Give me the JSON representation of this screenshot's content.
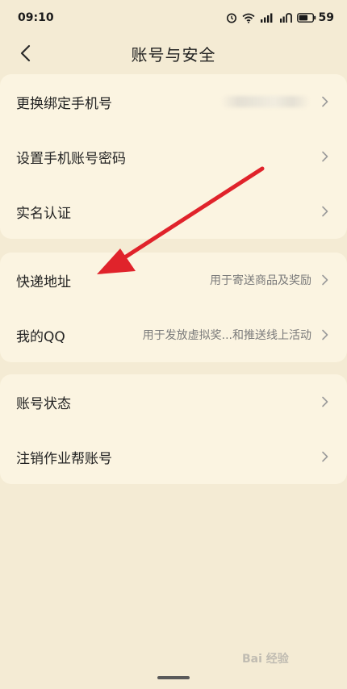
{
  "status_bar": {
    "time": "09:10",
    "battery": "59"
  },
  "nav": {
    "title": "账号与安全"
  },
  "groups": [
    {
      "rows": [
        {
          "label": "更换绑定手机号",
          "hint": ""
        },
        {
          "label": "设置手机账号密码",
          "hint": ""
        },
        {
          "label": "实名认证",
          "hint": ""
        }
      ]
    },
    {
      "rows": [
        {
          "label": "快递地址",
          "hint": "用于寄送商品及奖励"
        },
        {
          "label": "我的QQ",
          "hint": "用于发放虚拟奖...和推送线上活动"
        }
      ]
    },
    {
      "rows": [
        {
          "label": "账号状态",
          "hint": ""
        },
        {
          "label": "注销作业帮账号",
          "hint": ""
        }
      ]
    }
  ],
  "watermark": "Bai 经验",
  "colors": {
    "background": "#f4ebd4",
    "card": "#fbf4e1",
    "annotation_arrow": "#e0232b"
  },
  "icons": {
    "back": "chevron-left-icon",
    "row_arrow": "chevron-right-icon",
    "alarm": "alarm-icon",
    "wifi": "wifi-icon",
    "signal": "signal-icon",
    "battery": "battery-icon"
  }
}
